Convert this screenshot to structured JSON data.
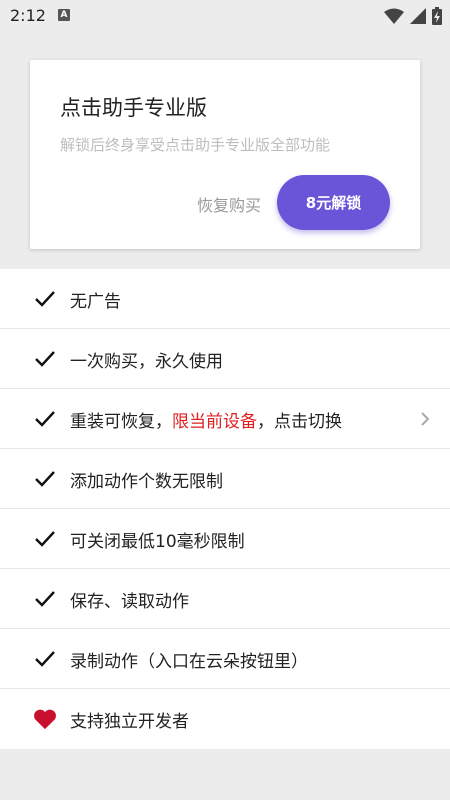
{
  "status_bar": {
    "time": "2:12",
    "notification_badge": "A"
  },
  "pro_card": {
    "title": "点击助手专业版",
    "subtitle": "解锁后终身享受点击助手专业版全部功能",
    "restore_label": "恢复购买",
    "unlock_label": "8元解锁",
    "accent_color": "#6a55d9"
  },
  "features": [
    {
      "icon": "check-icon",
      "text": "无广告"
    },
    {
      "icon": "check-icon",
      "text": "一次购买，永久使用"
    },
    {
      "icon": "check-icon",
      "text_before": "重装可恢复，",
      "text_highlight": "限当前设备",
      "text_after": "，点击切换",
      "highlight_color": "#e02020"
    },
    {
      "icon": "check-icon",
      "text": "添加动作个数无限制"
    },
    {
      "icon": "check-icon",
      "text": "可关闭最低10毫秒限制"
    },
    {
      "icon": "check-icon",
      "text": "保存、读取动作"
    },
    {
      "icon": "check-icon",
      "text": "录制动作（入口在云朵按钮里）"
    },
    {
      "icon": "heart-icon",
      "text": "支持独立开发者",
      "icon_color": "#c8102e"
    }
  ]
}
